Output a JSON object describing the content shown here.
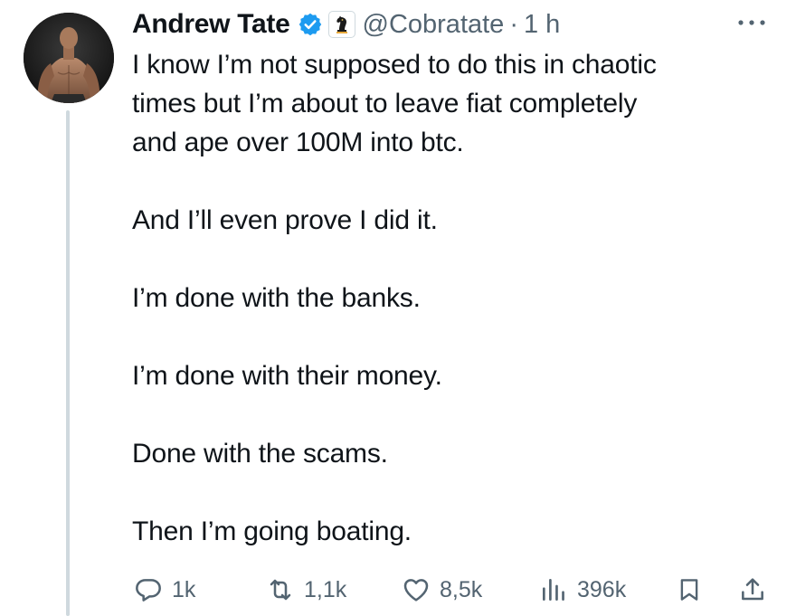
{
  "author": {
    "name": "Andrew Tate",
    "handle": "@Cobratate",
    "separator": "·",
    "time": "1 h",
    "verified": true,
    "avatar": "avatar-photo",
    "affiliate_badge": "chess-knight-badge"
  },
  "menu": {
    "icon": "more-horizontal-icon"
  },
  "tweet": {
    "lines": [
      "I know I’m not supposed to do this in chaotic",
      "times but I’m about to leave fiat completely",
      "and ape over 100M into btc.",
      "And I’ll even prove I did it.",
      "I’m done with the banks.",
      "I’m done with their money.",
      "Done with the scams.",
      "Then I’m going boating."
    ]
  },
  "actions": {
    "reply": {
      "icon": "reply-icon",
      "count": "1k"
    },
    "retweet": {
      "icon": "retweet-icon",
      "count": "1,1k"
    },
    "like": {
      "icon": "heart-icon",
      "count": "8,5k"
    },
    "views": {
      "icon": "views-icon",
      "count": "396k"
    },
    "bookmark": {
      "icon": "bookmark-icon"
    },
    "share": {
      "icon": "share-icon"
    }
  },
  "colors": {
    "text": "#0f1419",
    "muted": "#536471",
    "verified_blue": "#1d9bf0",
    "thread_line": "#cfd9de"
  }
}
